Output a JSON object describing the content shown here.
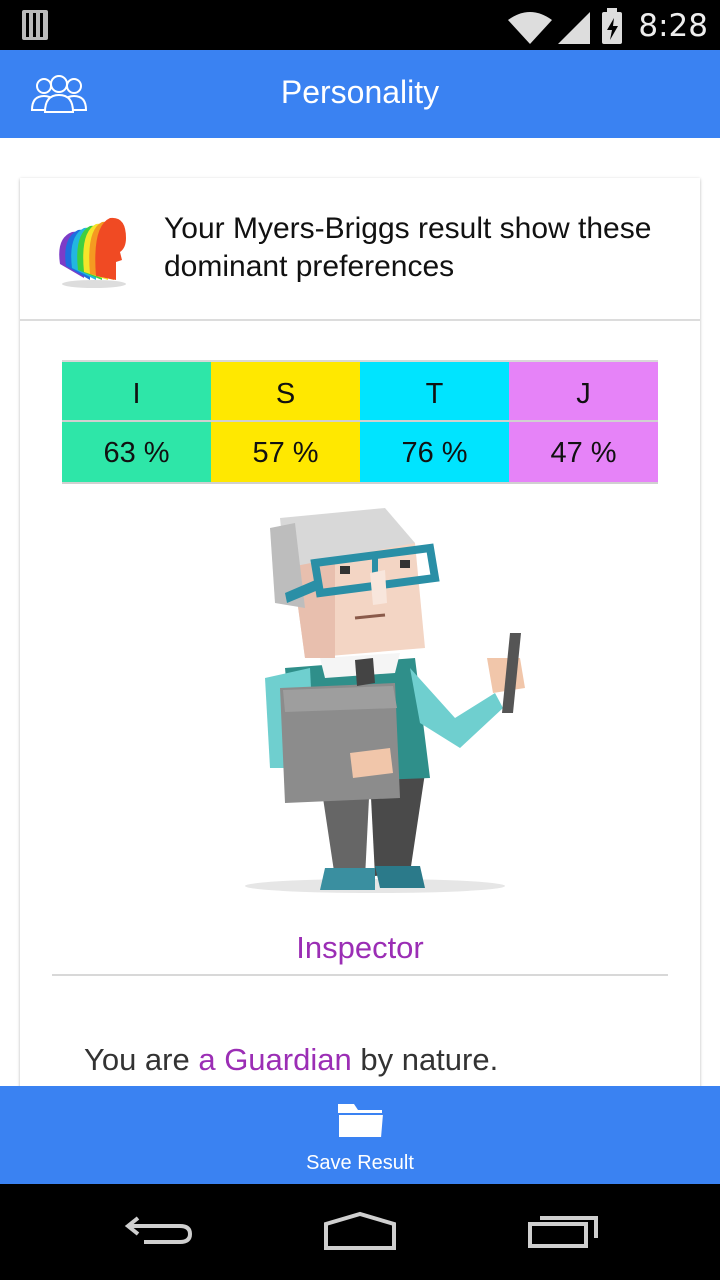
{
  "status_bar": {
    "time": "8:28",
    "icons": [
      "storage-icon",
      "wifi-icon",
      "signal-icon",
      "battery-charging-icon"
    ]
  },
  "app_bar": {
    "title": "Personality",
    "icon": "people-icon"
  },
  "card": {
    "header_icon": "colorful-heads-icon",
    "header_text": "Your Myers-Briggs result show these dominant preferences",
    "preferences": [
      {
        "letter": "I",
        "percent": "63 %",
        "color": "#2ee6a8"
      },
      {
        "letter": "S",
        "percent": "57 %",
        "color": "#ffe800"
      },
      {
        "letter": "T",
        "percent": "76 %",
        "color": "#00e4ff"
      },
      {
        "letter": "J",
        "percent": "47 %",
        "color": "#e683f8"
      }
    ],
    "illustration": "inspector-character",
    "type_name": "Inspector",
    "nature": {
      "prefix": "You are ",
      "highlight": "a Guardian",
      "suffix": " by nature."
    }
  },
  "action_bar": {
    "icon": "folder-icon",
    "label": "Save Result"
  },
  "nav_bar": {
    "buttons": [
      "back-icon",
      "home-icon",
      "recents-icon"
    ]
  },
  "colors": {
    "primary": "#3a82f2",
    "accent": "#9b2eb5"
  }
}
